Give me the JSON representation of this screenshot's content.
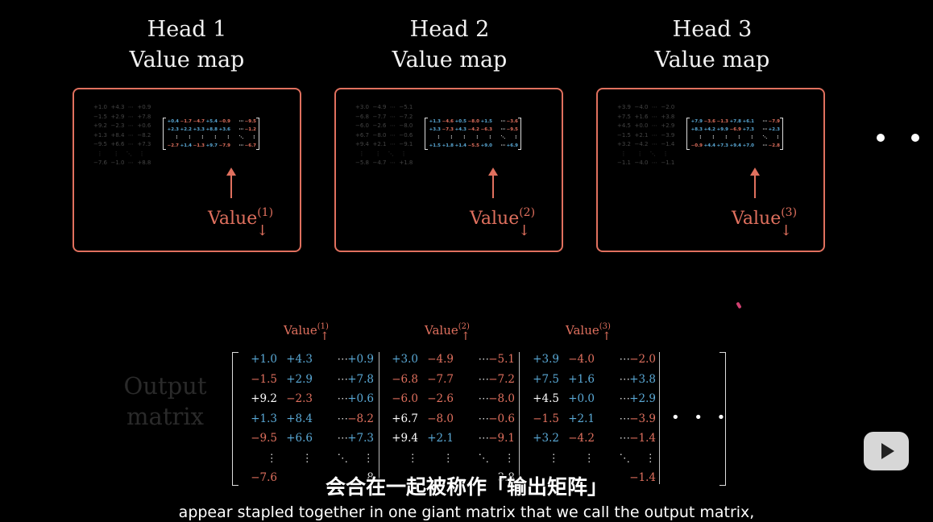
{
  "heads": [
    {
      "title_line1": "Head 1",
      "title_line2": "Value map",
      "value_label": "Value",
      "value_sup": "(1)",
      "arrow": "↓"
    },
    {
      "title_line1": "Head 2",
      "title_line2": "Value map",
      "value_label": "Value",
      "value_sup": "(2)",
      "arrow": "↓"
    },
    {
      "title_line1": "Head 3",
      "title_line2": "Value map",
      "value_label": "Value",
      "value_sup": "(3)",
      "arrow": "↓"
    }
  ],
  "column_labels": [
    {
      "label": "Value",
      "sup": "(1)",
      "arrow": "↑"
    },
    {
      "label": "Value",
      "sup": "(2)",
      "arrow": "↑"
    },
    {
      "label": "Value",
      "sup": "(3)",
      "arrow": "↑"
    }
  ],
  "output_label_line1": "Output",
  "output_label_line2": "matrix",
  "continuation_dots": "• • •",
  "subtitle_zh": "会合在一起被称作「输出矩阵」",
  "subtitle_en": "appear stapled together in one giant matrix that we call the output matrix,",
  "colors": {
    "accent": "#e0705e",
    "positive": "#5aa9d6",
    "background": "#000000"
  },
  "output_matrix": [
    [
      "+1.0",
      "+4.3",
      "⋯",
      "+0.9",
      "+3.0",
      "−4.9",
      "⋯",
      "−5.1",
      "+3.9",
      "−4.0",
      "⋯",
      "−2.0"
    ],
    [
      "−1.5",
      "+2.9",
      "⋯",
      "+7.8",
      "−6.8",
      "−7.7",
      "⋯",
      "−7.2",
      "+7.5",
      "+1.6",
      "⋯",
      "+3.8"
    ],
    [
      "+9.2",
      "−2.3",
      "⋯",
      "+0.6",
      "−6.0",
      "−2.6",
      "⋯",
      "−8.0",
      "+4.5",
      "+0.0",
      "⋯",
      "+2.9"
    ],
    [
      "+1.3",
      "+8.4",
      "⋯",
      "−8.2",
      "+6.7",
      "−8.0",
      "⋯",
      "−0.6",
      "−1.5",
      "+2.1",
      "⋯",
      "−3.9"
    ],
    [
      "−9.5",
      "+6.6",
      "⋯",
      "+7.3",
      "+9.4",
      "+2.1",
      "⋯",
      "−9.1",
      "+3.2",
      "−4.2",
      "⋯",
      "−1.4"
    ],
    [
      "⋮",
      "⋮",
      "⋱",
      "⋮",
      "⋮",
      "⋮",
      "⋱",
      "⋮",
      "⋮",
      "⋮",
      "⋱",
      "⋮"
    ],
    [
      "−7.6",
      "",
      "",
      "8",
      "",
      "",
      "",
      "3.8",
      "",
      "",
      "",
      "−1.4"
    ]
  ],
  "mini_matrices": [
    [
      [
        "+0.4",
        "−1.7",
        "−4.7",
        "+5.4",
        "−0.9",
        "⋯",
        "−9.5"
      ],
      [
        "+2.3",
        "+2.2",
        "+3.3",
        "+8.8",
        "+3.6",
        "⋯",
        "−1.2"
      ],
      [
        "⋮",
        "⋮",
        "⋮",
        "⋮",
        "⋮",
        "⋱",
        "⋮"
      ],
      [
        "−2.7",
        "+1.4",
        "−1.3",
        "+9.7",
        "−7.9",
        "⋯",
        "−6.7"
      ]
    ],
    [
      [
        "+1.3",
        "−4.6",
        "+0.5",
        "−8.0",
        "+1.5",
        "⋯",
        "−3.6"
      ],
      [
        "+3.3",
        "−7.3",
        "+4.3",
        "−4.2",
        "−6.3",
        "⋯",
        "−9.5"
      ],
      [
        "⋮",
        "⋮",
        "⋮",
        "⋮",
        "⋮",
        "⋱",
        "⋮"
      ],
      [
        "+1.5",
        "+1.8",
        "+1.4",
        "−5.5",
        "+9.0",
        "⋯",
        "+6.9"
      ]
    ],
    [
      [
        "+7.9",
        "−3.6",
        "−1.3",
        "+7.8",
        "+6.1",
        "⋯",
        "−7.9"
      ],
      [
        "+8.3",
        "+4.2",
        "+9.9",
        "−6.9",
        "+7.3",
        "⋯",
        "+2.3"
      ],
      [
        "⋮",
        "⋮",
        "⋮",
        "⋮",
        "⋮",
        "⋱",
        "⋮"
      ],
      [
        "−0.9",
        "+4.4",
        "+7.3",
        "+9.4",
        "+7.0",
        "⋯",
        "−2.8"
      ]
    ]
  ],
  "faint_matrices": [
    [
      "+1.0  +4.3  ⋯  +0.9",
      "−1.5  +2.9  ⋯  +7.8",
      "+9.2  −2.3  ⋯  +0.6",
      "+1.3  +8.4  ⋯  −8.2",
      "−9.5  +6.6  ⋯  +7.3",
      "  ⋮      ⋮    ⋱    ⋮",
      "−7.6  −1.0  ⋯  +8.8"
    ],
    [
      "+3.0  −4.9  ⋯  −5.1",
      "−6.8  −7.7  ⋯  −7.2",
      "−6.0  −2.6  ⋯  −8.0",
      "+6.7  −8.0  ⋯  −0.6",
      "+9.4  +2.1  ⋯  −9.1",
      "  ⋮      ⋮    ⋱    ⋮",
      "−5.8  −4.7  ⋯  +1.8"
    ],
    [
      "+3.9  −4.0  ⋯  −2.0",
      "+7.5  +1.6  ⋯  +3.8",
      "+4.5  +0.0  ⋯  +2.9",
      "−1.5  +2.1  ⋯  −3.9",
      "+3.2  −4.2  ⋯  −1.4",
      "  ⋮      ⋮    ⋱    ⋮",
      "−1.1  −4.0  ⋯  −1.1"
    ]
  ]
}
